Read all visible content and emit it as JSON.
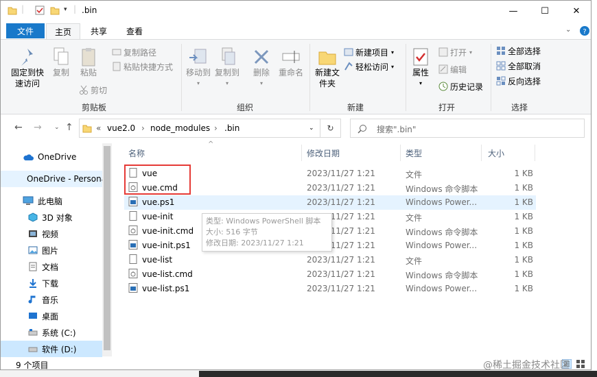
{
  "window": {
    "title": ".bin",
    "minimize_glyph": "—",
    "maximize_glyph": "☐",
    "close_glyph": "✕"
  },
  "tabs": {
    "file": "文件",
    "home": "主页",
    "share": "共享",
    "view": "查看"
  },
  "ribbon": {
    "clipboard": {
      "pin": "固定到快速访问",
      "copy": "复制",
      "paste": "粘贴",
      "copy_path": "复制路径",
      "paste_shortcut": "粘贴快捷方式",
      "cut": "剪切",
      "label": "剪贴板"
    },
    "organize": {
      "move_to": "移动到",
      "copy_to": "复制到",
      "delete": "删除",
      "rename": "重命名",
      "label": "组织"
    },
    "new": {
      "new_folder": "新建文件夹",
      "new_item": "新建项目",
      "easy_access": "轻松访问",
      "label": "新建"
    },
    "open": {
      "properties": "属性",
      "open": "打开",
      "edit": "编辑",
      "history": "历史记录",
      "label": "打开"
    },
    "select": {
      "select_all": "全部选择",
      "select_none": "全部取消",
      "invert": "反向选择",
      "label": "选择"
    }
  },
  "address": {
    "overflow": "«",
    "crumbs": [
      "vue2.0",
      "node_modules",
      ".bin"
    ],
    "search_placeholder": "搜索\".bin\""
  },
  "nav_pane": {
    "items": [
      {
        "label": "OneDrive",
        "icon": "cloud-icon"
      },
      {
        "label": "OneDrive - Personal",
        "icon": "cloud-icon"
      },
      {
        "label": "此电脑",
        "icon": "computer-icon"
      },
      {
        "label": "3D 对象",
        "icon": "cube-icon"
      },
      {
        "label": "视频",
        "icon": "video-icon"
      },
      {
        "label": "图片",
        "icon": "picture-icon"
      },
      {
        "label": "文档",
        "icon": "document-icon"
      },
      {
        "label": "下载",
        "icon": "download-icon"
      },
      {
        "label": "音乐",
        "icon": "music-icon"
      },
      {
        "label": "桌面",
        "icon": "desktop-icon"
      },
      {
        "label": "系统 (C:)",
        "icon": "drive-icon"
      },
      {
        "label": "软件 (D:)",
        "icon": "drive-icon"
      }
    ]
  },
  "file_list": {
    "columns": {
      "name": "名称",
      "date": "修改日期",
      "type": "类型",
      "size": "大小"
    },
    "rows": [
      {
        "name": "vue",
        "date": "2023/11/27 1:21",
        "type": "文件",
        "size": "1 KB",
        "icon": "file-icon"
      },
      {
        "name": "vue.cmd",
        "date": "2023/11/27 1:21",
        "type": "Windows 命令脚本",
        "size": "1 KB",
        "icon": "cmd-script-icon"
      },
      {
        "name": "vue.ps1",
        "date": "2023/11/27 1:21",
        "type": "Windows Power...",
        "size": "1 KB",
        "icon": "powershell-icon"
      },
      {
        "name": "vue-init",
        "date": "2023/11/27 1:21",
        "type": "文件",
        "size": "1 KB",
        "icon": "file-icon"
      },
      {
        "name": "vue-init.cmd",
        "date": "2023/11/27 1:21",
        "type": "Windows 命令脚本",
        "size": "1 KB",
        "icon": "cmd-script-icon"
      },
      {
        "name": "vue-init.ps1",
        "date": "2023/11/27 1:21",
        "type": "Windows Power...",
        "size": "1 KB",
        "icon": "powershell-icon"
      },
      {
        "name": "vue-list",
        "date": "2023/11/27 1:21",
        "type": "文件",
        "size": "1 KB",
        "icon": "file-icon"
      },
      {
        "name": "vue-list.cmd",
        "date": "2023/11/27 1:21",
        "type": "Windows 命令脚本",
        "size": "1 KB",
        "icon": "cmd-script-icon"
      },
      {
        "name": "vue-list.ps1",
        "date": "2023/11/27 1:21",
        "type": "Windows Power...",
        "size": "1 KB",
        "icon": "powershell-icon"
      }
    ]
  },
  "tooltip": {
    "type_line": "类型: Windows PowerShell 脚本",
    "size_line": "大小: 516 字节",
    "date_line": "修改日期: 2023/11/27 1:21"
  },
  "status": {
    "count": "9 个项目"
  },
  "watermark": "@稀土掘金技术社区",
  "colors": {
    "accent": "#1979ca",
    "highlight": "#e5f3ff",
    "annotation": "#e53935"
  }
}
